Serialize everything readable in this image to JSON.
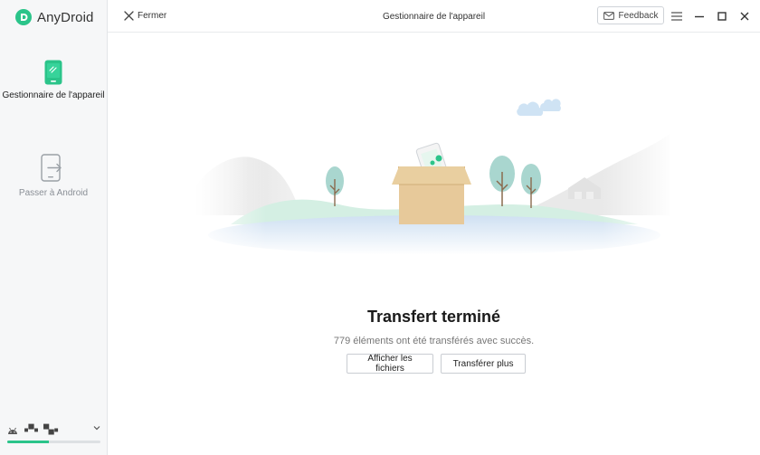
{
  "app": {
    "name": "AnyDroid"
  },
  "sidebar": {
    "items": [
      {
        "label": "Gestionnaire de l'appareil",
        "active": true,
        "icon": "phone-icon"
      },
      {
        "label": "Passer à Android",
        "active": false,
        "icon": "phone-transfer-icon"
      }
    ],
    "device": {
      "name": "▪▀▪ ▀▄▪",
      "storage_used_fraction": 0.45
    }
  },
  "titlebar": {
    "close_label": "Fermer",
    "title": "Gestionnaire de l'appareil",
    "feedback_label": "Feedback"
  },
  "main": {
    "result_title": "Transfert terminé",
    "result_desc": "779 éléments ont été transférés avec succès.",
    "buttons": {
      "show_files": "Afficher les fichiers",
      "transfer_more": "Transférer plus"
    }
  },
  "colors": {
    "accent": "#2bc48a",
    "box": "#e7c99a",
    "tree": "#a9d6cf"
  }
}
